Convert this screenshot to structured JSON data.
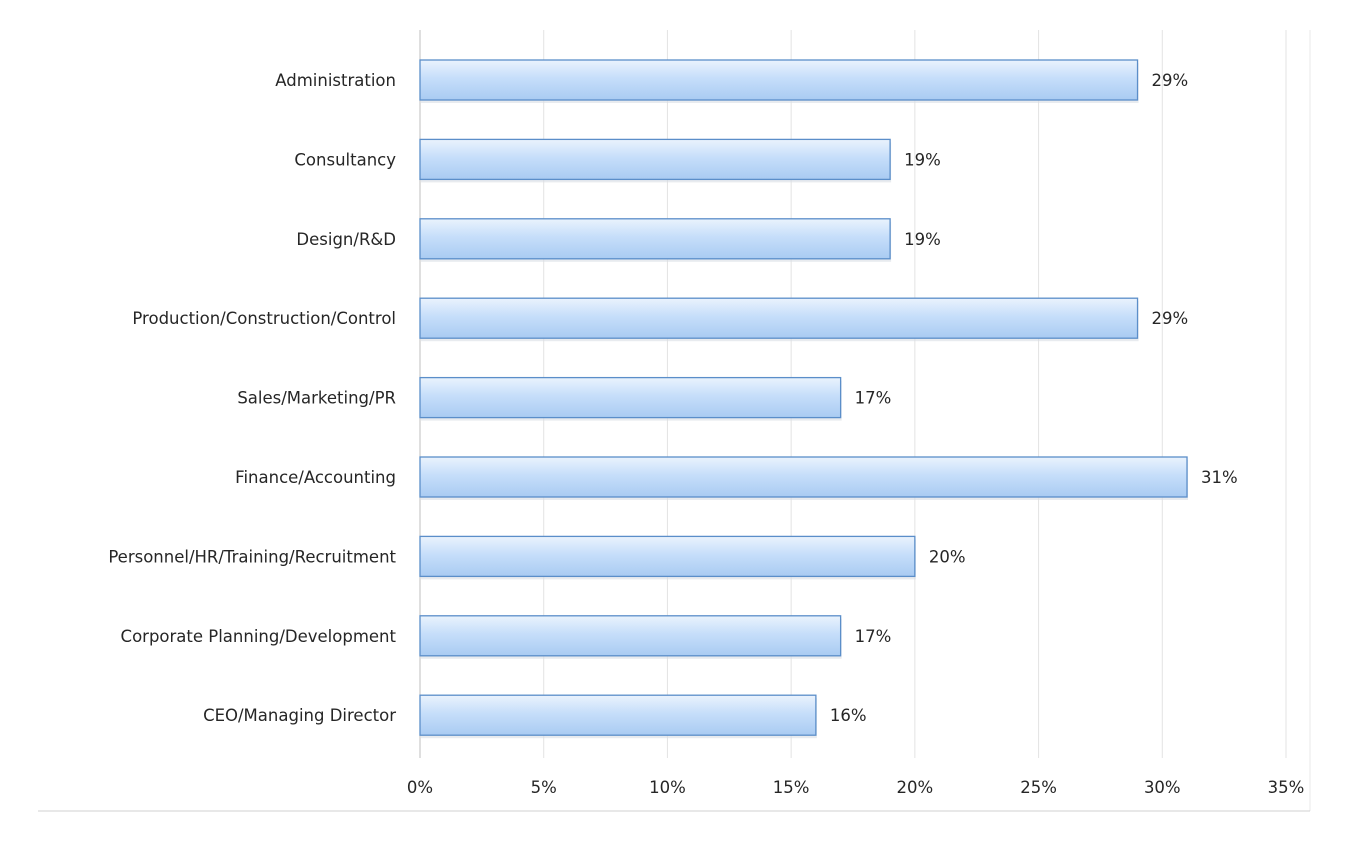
{
  "chart_data": {
    "type": "bar",
    "orientation": "horizontal",
    "categories": [
      "Administration",
      "Consultancy",
      "Design/R&D",
      "Production/Construction/Control",
      "Sales/Marketing/PR",
      "Finance/Accounting",
      "Personnel/HR/Training/Recruitment",
      "Corporate Planning/Development",
      "CEO/Managing Director"
    ],
    "values": [
      29,
      19,
      19,
      29,
      17,
      31,
      20,
      17,
      16
    ],
    "data_labels": [
      "29%",
      "19%",
      "19%",
      "29%",
      "17%",
      "31%",
      "20%",
      "17%",
      "16%"
    ],
    "xlim": [
      0,
      35
    ],
    "x_ticks": [
      0,
      5,
      10,
      15,
      20,
      25,
      30,
      35
    ],
    "x_tick_labels": [
      "0%",
      "5%",
      "10%",
      "15%",
      "20%",
      "25%",
      "30%",
      "35%"
    ],
    "title": "",
    "xlabel": "",
    "ylabel": "",
    "grid": "vertical",
    "legend": "none",
    "bar_color": "#bcd8f6",
    "bar_border_color": "#5b8ec9",
    "gridline_color": "#e3e3e3",
    "axis_color": "#bfbfbf",
    "text_color": "#262626"
  }
}
